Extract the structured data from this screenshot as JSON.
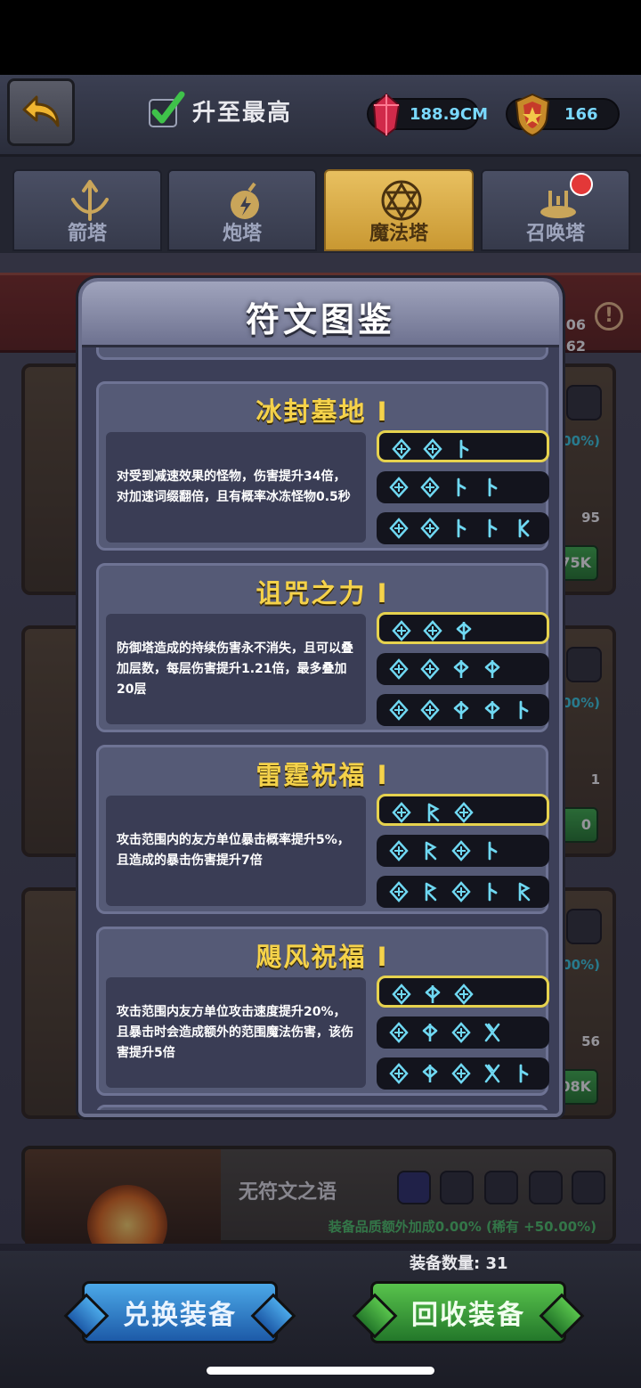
{
  "header": {
    "max_label": "升至最高",
    "gems": "188.9CM",
    "shield": "166"
  },
  "tabs": [
    {
      "label": "箭塔",
      "active": false
    },
    {
      "label": "炮塔",
      "active": false
    },
    {
      "label": "魔法塔",
      "active": true
    },
    {
      "label": "召唤塔",
      "active": false,
      "badge": true
    }
  ],
  "background": {
    "right_numbers": [
      "06",
      ".62"
    ],
    "cards": [
      {
        "pct": ".00%)",
        "bottom_num": "95",
        "btn": "75K"
      },
      {
        "pct": ".00%)",
        "bottom_num": "1",
        "btn": "0"
      },
      {
        "pct": ".00%)",
        "bottom_num": "56",
        "btn": ".08K"
      }
    ],
    "no_runeword": "无符文之语",
    "bonus": "装备品质额外加成0.00% (稀有 +50.00%)",
    "equip_count": "装备数量: 31"
  },
  "modal": {
    "title": "符文图鉴",
    "runewords": [
      {
        "title": "冰封墓地 I",
        "desc": "对受到减速效果的怪物，伤害提升34倍，对加速词缀翻倍，且有概率冰冻怪物0.5秒",
        "rows": [
          [
            "o",
            "o",
            "i"
          ],
          [
            "o",
            "o",
            "i",
            "i"
          ],
          [
            "o",
            "o",
            "i",
            "i",
            "k"
          ]
        ]
      },
      {
        "title": "诅咒之力 I",
        "desc": "防御塔造成的持续伤害永不消失，且可以叠加层数，每层伤害提升1.21倍，最多叠加20层",
        "rows": [
          [
            "o",
            "o",
            "p"
          ],
          [
            "o",
            "o",
            "p",
            "p"
          ],
          [
            "o",
            "o",
            "p",
            "p",
            "i"
          ]
        ]
      },
      {
        "title": "雷霆祝福 I",
        "desc": "攻击范围内的友方单位暴击概率提升5%，且造成的暴击伤害提升7倍",
        "rows": [
          [
            "o",
            "r",
            "o"
          ],
          [
            "o",
            "r",
            "o",
            "i"
          ],
          [
            "o",
            "r",
            "o",
            "i",
            "r"
          ]
        ]
      },
      {
        "title": "飓风祝福 I",
        "desc": "攻击范围内友方单位攻击速度提升20%，且暴击时会造成额外的范围魔法伤害，该伤害提升5倍",
        "rows": [
          [
            "o",
            "p",
            "o"
          ],
          [
            "o",
            "p",
            "o",
            "x"
          ],
          [
            "o",
            "p",
            "o",
            "x",
            "i"
          ]
        ]
      }
    ]
  },
  "buttons": {
    "exchange": "兑换装备",
    "recycle": "回收装备"
  },
  "colors": {
    "rune": "#6fd8f2",
    "title_gold": "#f5d24a",
    "active_row_border": "#e6d24e"
  }
}
